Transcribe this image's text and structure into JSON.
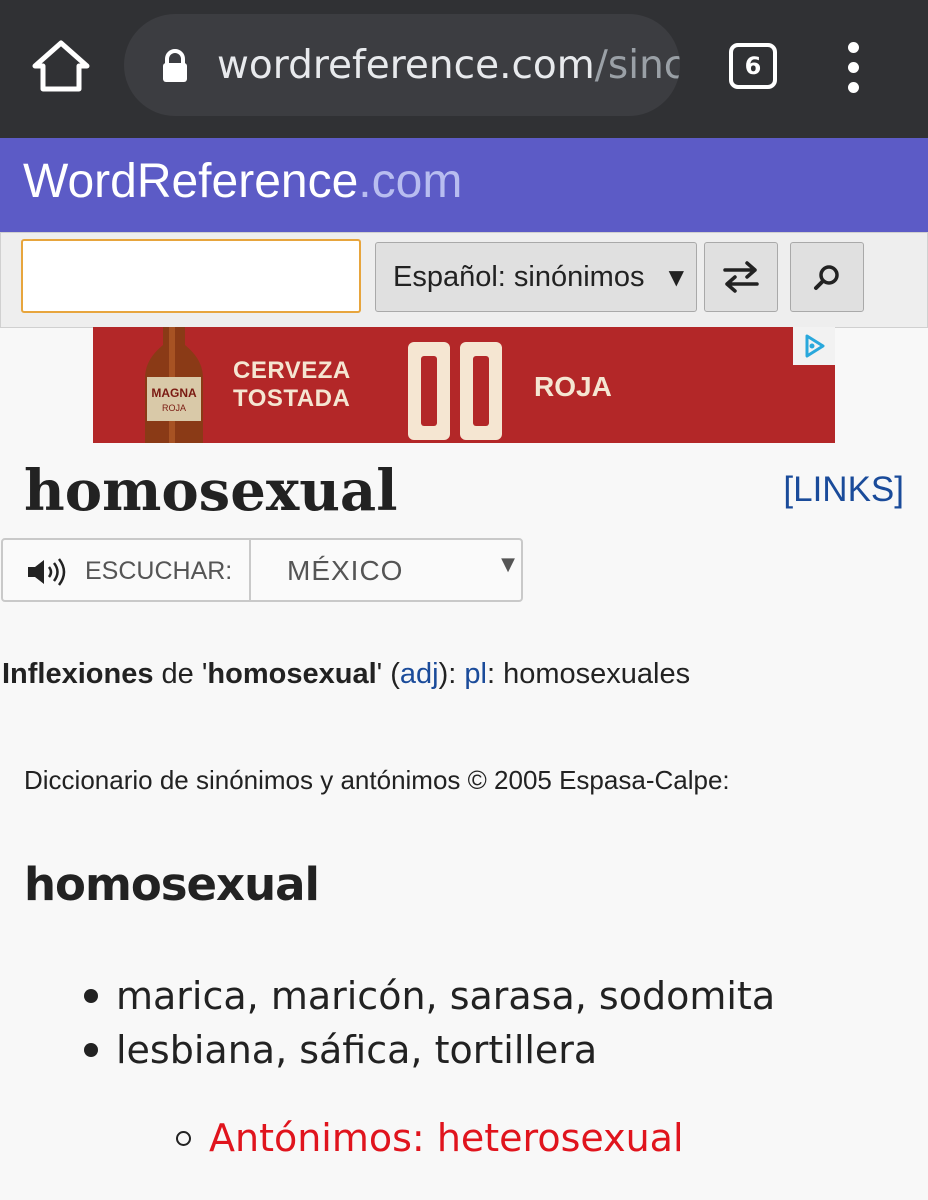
{
  "browser": {
    "url_host": "wordreference.com",
    "url_path": "/sinc",
    "tab_count": "6"
  },
  "site": {
    "logo_main": "WordReference",
    "logo_domain": ".com"
  },
  "search": {
    "value": "",
    "dictionary_selected": "Español: sinónimos"
  },
  "ad": {
    "bottle_label": "MAGNA ROJA",
    "line1": "CERVEZA",
    "line2": "TOSTADA",
    "line3": "ROJA"
  },
  "word": {
    "title": "homosexual",
    "links_label": "[LINKS]",
    "listen_label": "ESCUCHAR:",
    "region": "MÉXICO"
  },
  "inflections": {
    "label": "Inflexiones",
    "de": " de '",
    "word": "homosexual",
    "open": "' (",
    "pos": "adj",
    "close": "): ",
    "pl_label": "pl",
    "pl_sep": ": ",
    "pl_value": "homosexuales"
  },
  "source": "Diccionario de sinónimos y antónimos © 2005 Espasa-Calpe:",
  "entry": {
    "headword": "homosexual",
    "senses": [
      "marica, maricón, sarasa, sodomita",
      "lesbiana, sáfica, tortillera"
    ],
    "antonyms": "Antónimos: heterosexual"
  },
  "colors": {
    "site_header": "#5c5bc6",
    "link": "#1a4b9a",
    "antonym": "#e0141d",
    "ad_background": "#b32728"
  }
}
